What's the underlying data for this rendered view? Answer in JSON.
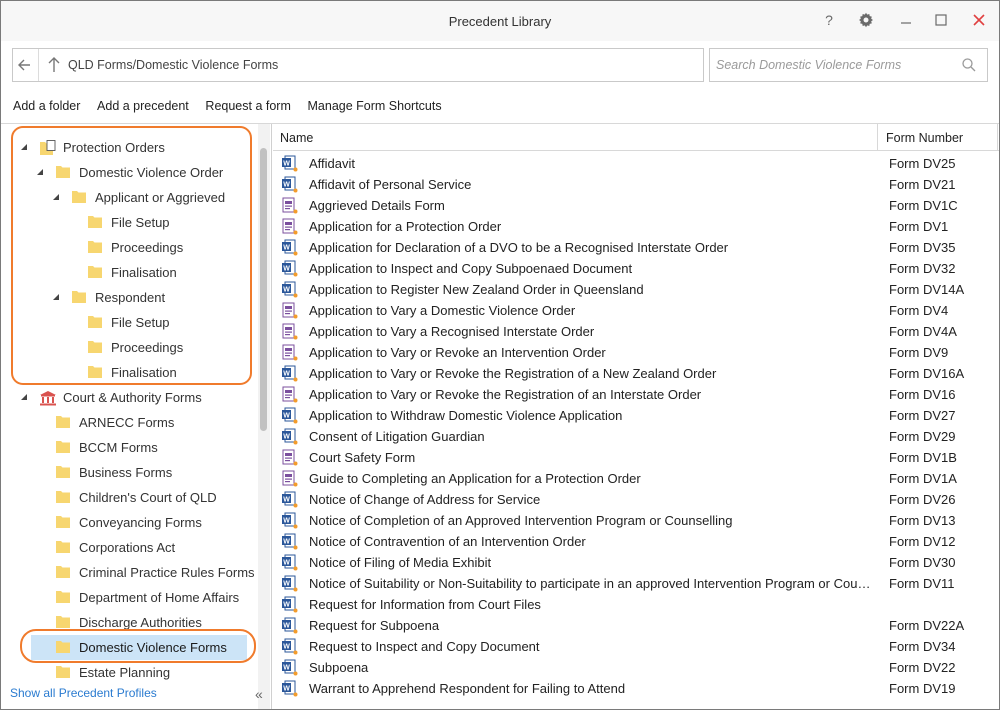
{
  "window": {
    "title": "Precedent Library",
    "help_label": "?",
    "colors": {
      "accent": "#f07b2c",
      "selection": "#cce4f7",
      "link": "#2a7bd0",
      "folder": "#f7d670"
    }
  },
  "address_bar": {
    "path": "QLD Forms/Domestic Violence Forms"
  },
  "search": {
    "placeholder": "Search Domestic Violence Forms"
  },
  "actions": [
    "Add a folder",
    "Add a precedent",
    "Request a form",
    "Manage Form Shortcuts"
  ],
  "tree": {
    "items": [
      {
        "label": "Protection Orders",
        "level": 0,
        "expanded": true,
        "icon": "folder-document-icon"
      },
      {
        "label": "Domestic Violence Order",
        "level": 1,
        "expanded": true,
        "icon": "folder-icon"
      },
      {
        "label": "Applicant or Aggrieved",
        "level": 2,
        "expanded": true,
        "icon": "folder-icon"
      },
      {
        "label": "File Setup",
        "level": 3,
        "expanded": null,
        "icon": "folder-icon"
      },
      {
        "label": "Proceedings",
        "level": 3,
        "expanded": null,
        "icon": "folder-icon"
      },
      {
        "label": "Finalisation",
        "level": 3,
        "expanded": null,
        "icon": "folder-icon"
      },
      {
        "label": "Respondent",
        "level": 2,
        "expanded": true,
        "icon": "folder-icon"
      },
      {
        "label": "File Setup",
        "level": 3,
        "expanded": null,
        "icon": "folder-icon"
      },
      {
        "label": "Proceedings",
        "level": 3,
        "expanded": null,
        "icon": "folder-icon"
      },
      {
        "label": "Finalisation",
        "level": 3,
        "expanded": null,
        "icon": "folder-icon"
      },
      {
        "label": "Court & Authority Forms",
        "level": 0,
        "expanded": true,
        "icon": "courthouse-icon"
      },
      {
        "label": "ARNECC Forms",
        "level": 1,
        "expanded": null,
        "icon": "folder-icon"
      },
      {
        "label": "BCCM Forms",
        "level": 1,
        "expanded": null,
        "icon": "folder-icon"
      },
      {
        "label": "Business Forms",
        "level": 1,
        "expanded": null,
        "icon": "folder-icon"
      },
      {
        "label": "Children's Court of QLD",
        "level": 1,
        "expanded": null,
        "icon": "folder-icon"
      },
      {
        "label": "Conveyancing Forms",
        "level": 1,
        "expanded": null,
        "icon": "folder-icon"
      },
      {
        "label": "Corporations Act",
        "level": 1,
        "expanded": null,
        "icon": "folder-icon"
      },
      {
        "label": "Criminal Practice Rules Forms",
        "level": 1,
        "expanded": null,
        "icon": "folder-icon"
      },
      {
        "label": "Department of Home Affairs",
        "level": 1,
        "expanded": null,
        "icon": "folder-icon"
      },
      {
        "label": "Discharge Authorities",
        "level": 1,
        "expanded": null,
        "icon": "folder-icon"
      },
      {
        "label": "Domestic Violence Forms",
        "level": 1,
        "expanded": null,
        "icon": "folder-icon",
        "selected": true
      },
      {
        "label": "Estate Planning",
        "level": 1,
        "expanded": null,
        "icon": "folder-icon"
      }
    ],
    "show_all_label": "Show all Precedent Profiles",
    "collapse_label": "«"
  },
  "list": {
    "columns": [
      "Name",
      "Form Number"
    ],
    "rows": [
      {
        "name": "Affidavit",
        "form": "Form DV25",
        "type": "word"
      },
      {
        "name": "Affidavit of Personal Service",
        "form": "Form DV21",
        "type": "word"
      },
      {
        "name": "Aggrieved Details Form",
        "form": "Form DV1C",
        "type": "court"
      },
      {
        "name": "Application for a Protection Order",
        "form": "Form DV1",
        "type": "court"
      },
      {
        "name": "Application for Declaration of a DVO to be a Recognised Interstate Order",
        "form": "Form DV35",
        "type": "word"
      },
      {
        "name": "Application to Inspect and Copy Subpoenaed Document",
        "form": "Form DV32",
        "type": "word"
      },
      {
        "name": "Application to Register New Zealand Order in Queensland",
        "form": "Form DV14A",
        "type": "word"
      },
      {
        "name": "Application to Vary a Domestic Violence Order",
        "form": "Form DV4",
        "type": "court"
      },
      {
        "name": "Application to Vary a Recognised Interstate Order",
        "form": "Form DV4A",
        "type": "court"
      },
      {
        "name": "Application to Vary or Revoke an Intervention Order",
        "form": "Form DV9",
        "type": "court"
      },
      {
        "name": "Application to Vary or Revoke the Registration of a New Zealand Order",
        "form": "Form DV16A",
        "type": "word"
      },
      {
        "name": "Application to Vary or Revoke the Registration of an Interstate Order",
        "form": "Form DV16",
        "type": "court"
      },
      {
        "name": "Application to Withdraw Domestic Violence Application",
        "form": "Form DV27",
        "type": "word"
      },
      {
        "name": "Consent of Litigation Guardian",
        "form": "Form DV29",
        "type": "word"
      },
      {
        "name": "Court Safety Form",
        "form": "Form DV1B",
        "type": "court"
      },
      {
        "name": "Guide to Completing an Application for a Protection Order",
        "form": "Form DV1A",
        "type": "court"
      },
      {
        "name": "Notice of Change of Address for Service",
        "form": "Form DV26",
        "type": "word"
      },
      {
        "name": "Notice of Completion of an Approved Intervention Program or Counselling",
        "form": "Form DV13",
        "type": "word"
      },
      {
        "name": "Notice of Contravention of an Intervention Order",
        "form": "Form DV12",
        "type": "word"
      },
      {
        "name": "Notice of Filing of Media Exhibit",
        "form": "Form DV30",
        "type": "word"
      },
      {
        "name": "Notice of Suitability or Non-Suitability to participate in an approved Intervention Program or Counselling",
        "form": "Form DV11",
        "type": "word"
      },
      {
        "name": "Request for Information from Court Files",
        "form": "",
        "type": "word"
      },
      {
        "name": "Request for Subpoena",
        "form": "Form DV22A",
        "type": "word"
      },
      {
        "name": "Request to Inspect and Copy Document",
        "form": "Form DV34",
        "type": "word"
      },
      {
        "name": "Subpoena",
        "form": "Form DV22",
        "type": "word"
      },
      {
        "name": "Warrant to Apprehend Respondent for Failing to Attend",
        "form": "Form DV19",
        "type": "word"
      }
    ]
  }
}
